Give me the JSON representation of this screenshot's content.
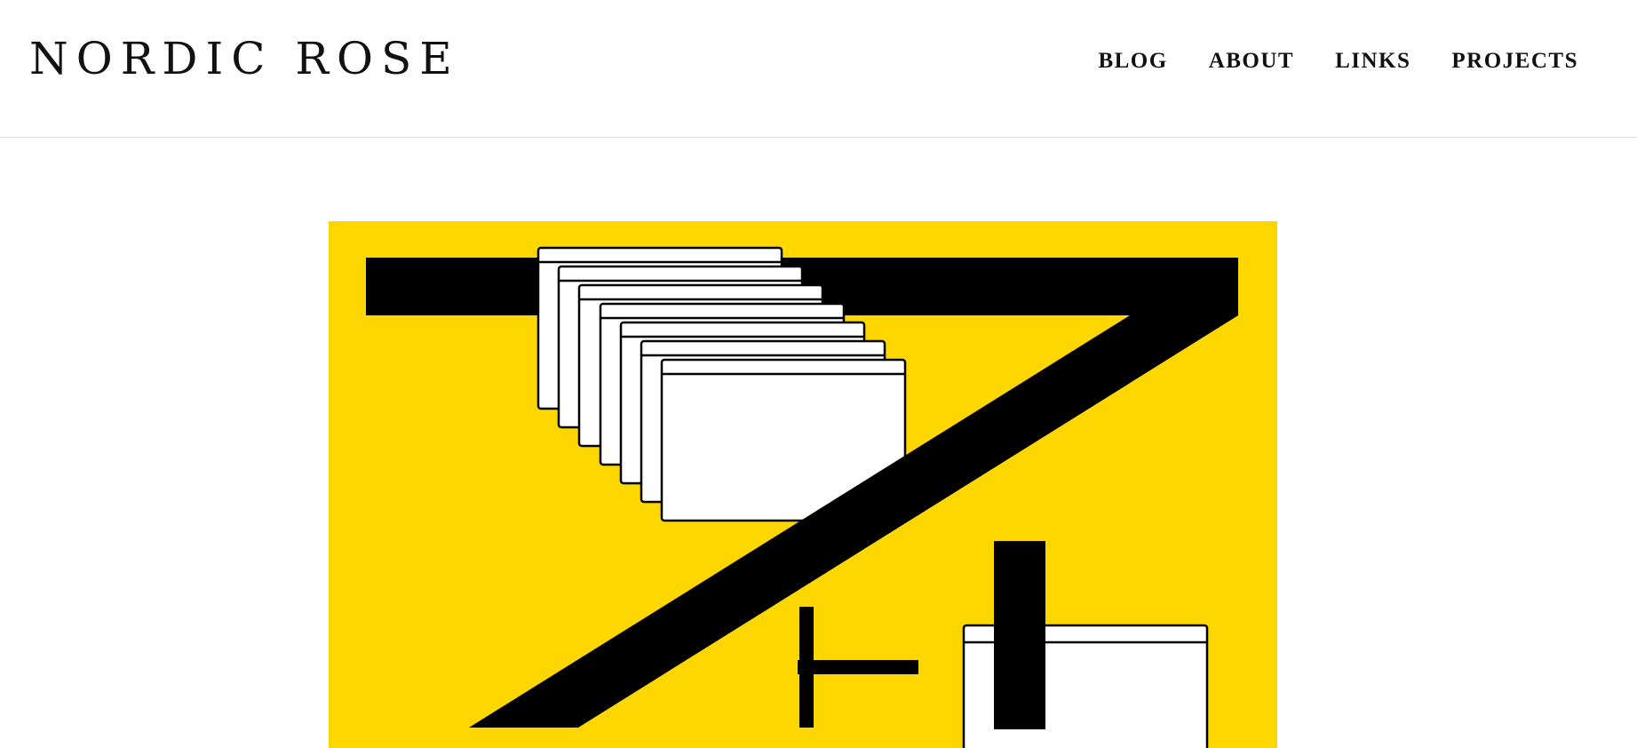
{
  "site": {
    "title": "NORDIC ROSE"
  },
  "nav": {
    "items": [
      {
        "id": "blog",
        "label": "BLOG"
      },
      {
        "id": "about",
        "label": "ABOUT"
      },
      {
        "id": "links",
        "label": "LINKS"
      },
      {
        "id": "projects",
        "label": "PROJECTS"
      }
    ]
  },
  "hero": {
    "icon": "windows-7-plus-artwork",
    "colors": {
      "background": "#FFD700",
      "ink": "#000000",
      "paper": "#FFFFFF"
    }
  }
}
